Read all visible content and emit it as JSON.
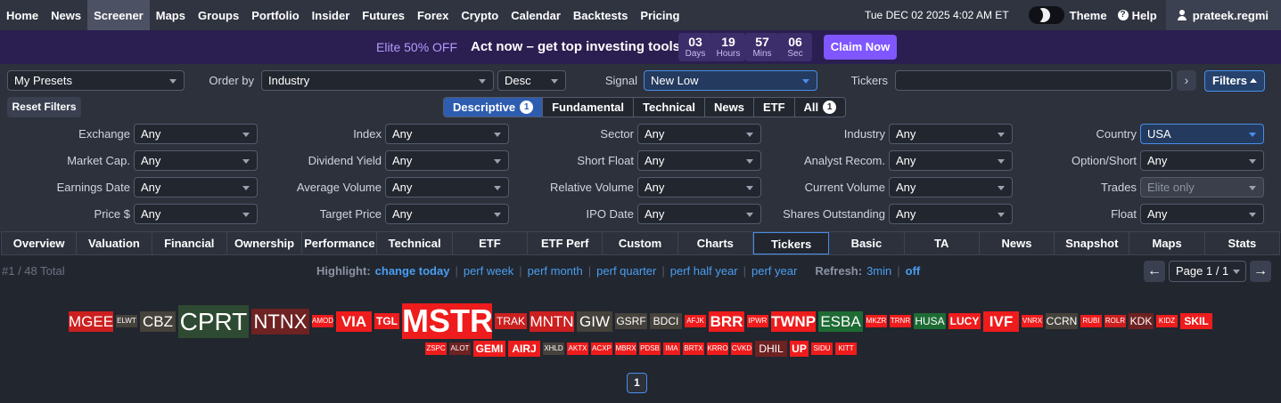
{
  "nav": {
    "items": [
      "Home",
      "News",
      "Screener",
      "Maps",
      "Groups",
      "Portfolio",
      "Insider",
      "Futures",
      "Forex",
      "Crypto",
      "Calendar",
      "Backtests",
      "Pricing"
    ],
    "active": "Screener",
    "datetime": "Tue DEC 02 2025 4:02 AM ET",
    "theme_label": "Theme",
    "help_label": "Help",
    "help_glyph": "?",
    "user": "prateek.regmi"
  },
  "promo": {
    "offer": "Elite 50% OFF",
    "text": "Act now – get top investing tools",
    "countdown": [
      {
        "value": "03",
        "unit": "Days"
      },
      {
        "value": "19",
        "unit": "Hours"
      },
      {
        "value": "57",
        "unit": "Mins"
      },
      {
        "value": "06",
        "unit": "Sec"
      }
    ],
    "cta": "Claim Now"
  },
  "controls": {
    "presets": "My Presets",
    "order_by_label": "Order by",
    "order_by": "Industry",
    "order_dir": "Desc",
    "signal_label": "Signal",
    "signal": "New Low",
    "tickers_label": "Tickers",
    "tickers_value": "",
    "go_glyph": "›",
    "filters_button": "Filters",
    "reset_button": "Reset Filters"
  },
  "filter_tabs": [
    {
      "label": "Descriptive",
      "badge": "1",
      "active": true
    },
    {
      "label": "Fundamental",
      "badge": "",
      "active": false
    },
    {
      "label": "Technical",
      "badge": "",
      "active": false
    },
    {
      "label": "News",
      "badge": "",
      "active": false
    },
    {
      "label": "ETF",
      "badge": "",
      "active": false
    },
    {
      "label": "All",
      "badge": "1",
      "active": false
    }
  ],
  "filters": [
    [
      {
        "label": "Exchange",
        "value": "Any"
      },
      {
        "label": "Index",
        "value": "Any"
      },
      {
        "label": "Sector",
        "value": "Any"
      },
      {
        "label": "Industry",
        "value": "Any"
      },
      {
        "label": "Country",
        "value": "USA",
        "state": "active"
      }
    ],
    [
      {
        "label": "Market Cap.",
        "value": "Any"
      },
      {
        "label": "Dividend Yield",
        "value": "Any"
      },
      {
        "label": "Short Float",
        "value": "Any"
      },
      {
        "label": "Analyst Recom.",
        "value": "Any"
      },
      {
        "label": "Option/Short",
        "value": "Any"
      }
    ],
    [
      {
        "label": "Earnings Date",
        "value": "Any"
      },
      {
        "label": "Average Volume",
        "value": "Any"
      },
      {
        "label": "Relative Volume",
        "value": "Any"
      },
      {
        "label": "Current Volume",
        "value": "Any"
      },
      {
        "label": "Trades",
        "value": "Elite only",
        "state": "disabled"
      }
    ],
    [
      {
        "label": "Price $",
        "value": "Any"
      },
      {
        "label": "Target Price",
        "value": "Any"
      },
      {
        "label": "IPO Date",
        "value": "Any"
      },
      {
        "label": "Shares Outstanding",
        "value": "Any"
      },
      {
        "label": "Float",
        "value": "Any"
      }
    ]
  ],
  "view_tabs": [
    "Overview",
    "Valuation",
    "Financial",
    "Ownership",
    "Performance",
    "Technical",
    "ETF",
    "ETF Perf",
    "Custom",
    "Charts",
    "Tickers",
    "Basic",
    "TA",
    "News",
    "Snapshot",
    "Maps",
    "Stats"
  ],
  "view_tab_active": "Tickers",
  "results": {
    "total": "#1 / 48 Total",
    "highlight_label": "Highlight:",
    "highlight_options": [
      "change today",
      "perf week",
      "perf month",
      "perf quarter",
      "perf half year",
      "perf year"
    ],
    "highlight_active": "change today",
    "refresh_label": "Refresh:",
    "refresh_options": [
      "3min",
      "off"
    ],
    "refresh_active": "off",
    "page_select": "Page 1 / 1",
    "prev_glyph": "←",
    "next_glyph": "→",
    "current_page": "1"
  },
  "colors": {
    "red": "#cc1f1f",
    "bright_red": "#ee1c1c",
    "dark_red": "#6e2222",
    "neutral": "#45413b",
    "dark_green": "#2f4a32",
    "green": "#1d6b33",
    "accent": "#4a8ee8"
  },
  "tickers": [
    {
      "symbol": "MGEE",
      "tone": "red",
      "size": 2
    },
    {
      "symbol": "ELWT",
      "tone": "neutral",
      "size": 0
    },
    {
      "symbol": "CBZ",
      "tone": "neutral",
      "size": 2
    },
    {
      "symbol": "CPRT",
      "tone": "dark_green",
      "size": 4
    },
    {
      "symbol": "NTNX",
      "tone": "dark_red",
      "size": 3
    },
    {
      "symbol": "AMOD",
      "tone": "bright_red",
      "size": 0
    },
    {
      "symbol": "VIA",
      "tone": "bright_red",
      "size": 2
    },
    {
      "symbol": "TGL",
      "tone": "bright_red",
      "size": 1
    },
    {
      "symbol": "MSTR",
      "tone": "bright_red",
      "size": 5
    },
    {
      "symbol": "TRAK",
      "tone": "red",
      "size": 1
    },
    {
      "symbol": "MNTN",
      "tone": "red",
      "size": 2
    },
    {
      "symbol": "GIW",
      "tone": "neutral",
      "size": 2
    },
    {
      "symbol": "GSRF",
      "tone": "neutral",
      "size": 1
    },
    {
      "symbol": "BDCI",
      "tone": "neutral",
      "size": 1
    },
    {
      "symbol": "AFJK",
      "tone": "bright_red",
      "size": 0
    },
    {
      "symbol": "BRR",
      "tone": "bright_red",
      "size": 2
    },
    {
      "symbol": "IPWR",
      "tone": "bright_red",
      "size": 0
    },
    {
      "symbol": "TWNP",
      "tone": "bright_red",
      "size": 2
    },
    {
      "symbol": "ESBA",
      "tone": "green",
      "size": 2
    },
    {
      "symbol": "MKZR",
      "tone": "bright_red",
      "size": 0
    },
    {
      "symbol": "TRNR",
      "tone": "bright_red",
      "size": 0
    },
    {
      "symbol": "HUSA",
      "tone": "green",
      "size": 1
    },
    {
      "symbol": "LUCY",
      "tone": "bright_red",
      "size": 1
    },
    {
      "symbol": "IVF",
      "tone": "bright_red",
      "size": 2
    },
    {
      "symbol": "VNRX",
      "tone": "bright_red",
      "size": 0
    },
    {
      "symbol": "CCRN",
      "tone": "neutral",
      "size": 1
    },
    {
      "symbol": "RUBI",
      "tone": "bright_red",
      "size": 0
    },
    {
      "symbol": "ROLR",
      "tone": "red",
      "size": 0
    },
    {
      "symbol": "KDK",
      "tone": "dark_red",
      "size": 1
    },
    {
      "symbol": "KIDZ",
      "tone": "bright_red",
      "size": 0
    },
    {
      "symbol": "SKIL",
      "tone": "bright_red",
      "size": 1
    },
    {
      "symbol": "ZSPC",
      "tone": "bright_red",
      "size": 0
    },
    {
      "symbol": "ALOT",
      "tone": "dark_red",
      "size": 0
    },
    {
      "symbol": "GEMI",
      "tone": "bright_red",
      "size": 1
    },
    {
      "symbol": "AIRJ",
      "tone": "bright_red",
      "size": 1
    },
    {
      "symbol": "XHLD",
      "tone": "neutral",
      "size": 0
    },
    {
      "symbol": "AKTX",
      "tone": "bright_red",
      "size": 0
    },
    {
      "symbol": "ACXP",
      "tone": "bright_red",
      "size": 0
    },
    {
      "symbol": "MBRX",
      "tone": "bright_red",
      "size": 0
    },
    {
      "symbol": "PDSB",
      "tone": "bright_red",
      "size": 0
    },
    {
      "symbol": "IMA",
      "tone": "bright_red",
      "size": 0
    },
    {
      "symbol": "BRTX",
      "tone": "bright_red",
      "size": 0
    },
    {
      "symbol": "KRRO",
      "tone": "bright_red",
      "size": 0
    },
    {
      "symbol": "CVKD",
      "tone": "bright_red",
      "size": 0
    },
    {
      "symbol": "DHIL",
      "tone": "dark_red",
      "size": 1
    },
    {
      "symbol": "UP",
      "tone": "bright_red",
      "size": 1
    },
    {
      "symbol": "SIDU",
      "tone": "bright_red",
      "size": 0
    },
    {
      "symbol": "KITT",
      "tone": "bright_red",
      "size": 0
    }
  ]
}
